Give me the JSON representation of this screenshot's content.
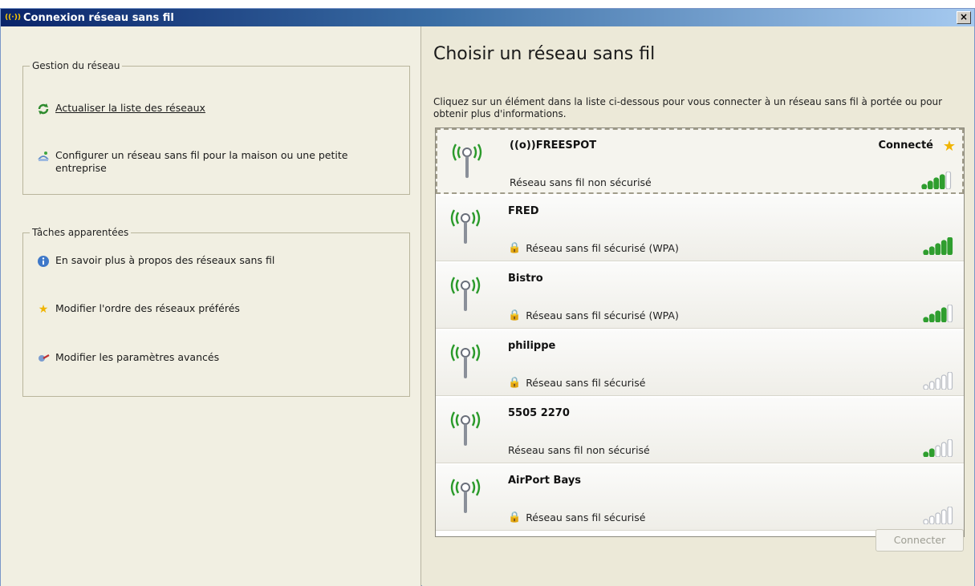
{
  "window": {
    "title": "Connexion réseau sans fil",
    "close_label": "×"
  },
  "left_pane": {
    "network_group": {
      "legend": "Gestion du réseau",
      "items": [
        {
          "icon": "refresh-icon",
          "label": "Actualiser la liste des réseaux"
        },
        {
          "icon": "wizard-icon",
          "label": "Configurer un réseau sans fil pour la maison ou une petite entreprise"
        }
      ]
    },
    "tasks_group": {
      "legend": "Tâches apparentées",
      "items": [
        {
          "icon": "info-icon",
          "label": "En savoir plus à propos des réseaux sans fil"
        },
        {
          "icon": "star-icon",
          "label": "Modifier l'ordre des réseaux préférés"
        },
        {
          "icon": "settings-icon",
          "label": "Modifier les paramètres avancés"
        }
      ]
    }
  },
  "right_pane": {
    "heading": "Choisir un réseau sans fil",
    "intro": "Cliquez sur un élément dans la liste ci-dessous pour vous connecter à un réseau sans fil à portée ou pour obtenir plus d'informations.",
    "networks": [
      {
        "ssid": "((o))FREESPOT",
        "status": "Connecté",
        "security": "Réseau sans fil non sécurisé",
        "secured": false,
        "bars": 4,
        "selected": true
      },
      {
        "ssid": "FRED",
        "status": "",
        "security": "Réseau sans fil sécurisé (WPA)",
        "secured": true,
        "bars": 5,
        "selected": false
      },
      {
        "ssid": "Bistro",
        "status": "",
        "security": "Réseau sans fil sécurisé (WPA)",
        "secured": true,
        "bars": 4,
        "selected": false
      },
      {
        "ssid": "philippe",
        "status": "",
        "security": "Réseau sans fil sécurisé",
        "secured": true,
        "bars": 0,
        "selected": false
      },
      {
        "ssid": "5505 2270",
        "status": "",
        "security": "Réseau sans fil non sécurisé",
        "secured": false,
        "bars": 2,
        "selected": false
      },
      {
        "ssid": "AirPort Bays",
        "status": "",
        "security": "Réseau sans fil sécurisé",
        "secured": true,
        "bars": 0,
        "selected": false
      }
    ],
    "connect_label": "Connecter"
  },
  "colors": {
    "signal_on": "#2f9e2f",
    "signal_off": "#b8bcc4",
    "antenna_green": "#2a9a2a",
    "lock": "#e8b800"
  }
}
